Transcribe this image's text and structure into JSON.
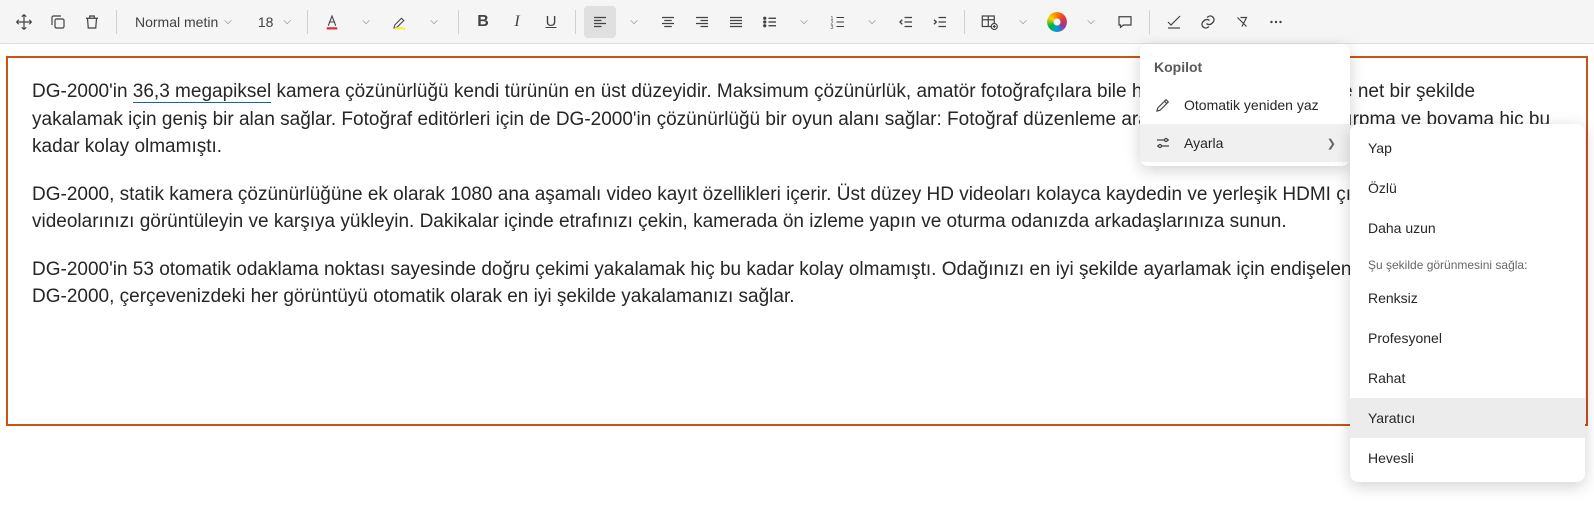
{
  "toolbar": {
    "style_name": "Normal metin",
    "font_size": "18"
  },
  "doc": {
    "p1a": "DG-2000'in ",
    "p1_spell": "36,3 megapiksel",
    "p1b": " kamera çözünürlüğü kendi türünün en üst düzeyidir. Maksimum çözünürlük, amatör fotoğrafçılara bile her ayrıntıyı tek bir karede net bir şekilde yakalamak için geniş bir alan sağlar. Fotoğraf editörleri için de DG-2000'in çözünürlüğü bir oyun alanı sağlar: Fotoğraf düzenleme araçlarıyla yakınlaştırma, kırpma ve boyama hiç bu kadar kolay olmamıştı.",
    "p2": "DG-2000, statik kamera çözünürlüğüne ek olarak 1080 ana aşamalı video kayıt özellikleri içerir. Üst düzey HD videoları kolayca kaydedin ve yerleşik HDMI çıkışlarını kullanarak videolarınızı görüntüleyin ve karşıya yükleyin. Dakikalar içinde etrafınızı çekin, kamerada ön izleme yapın ve oturma odanızda arkadaşlarınıza sunun.",
    "p3": "DG-2000'in 53 otomatik odaklama noktası sayesinde doğru çekimi yakalamak hiç bu kadar kolay olmamıştı. Odağınızı en iyi şekilde ayarlamak için endişelenmenize asla gerek yok; DG-2000, çerçevenizdeki her görüntüyü otomatik olarak en iyi şekilde yakalamanızı sağlar."
  },
  "menu1": {
    "title": "Kopilot",
    "item1": "Otomatik yeniden yaz",
    "item2": "Ayarla"
  },
  "menu2": {
    "i1": "Yap",
    "i2": "Özlü",
    "i3": "Daha uzun",
    "header": "Şu şekilde görünmesini sağla:",
    "i4": "Renksiz",
    "i5": "Profesyonel",
    "i6": "Rahat",
    "i7": "Yaratıcı",
    "i8": "Hevesli"
  }
}
